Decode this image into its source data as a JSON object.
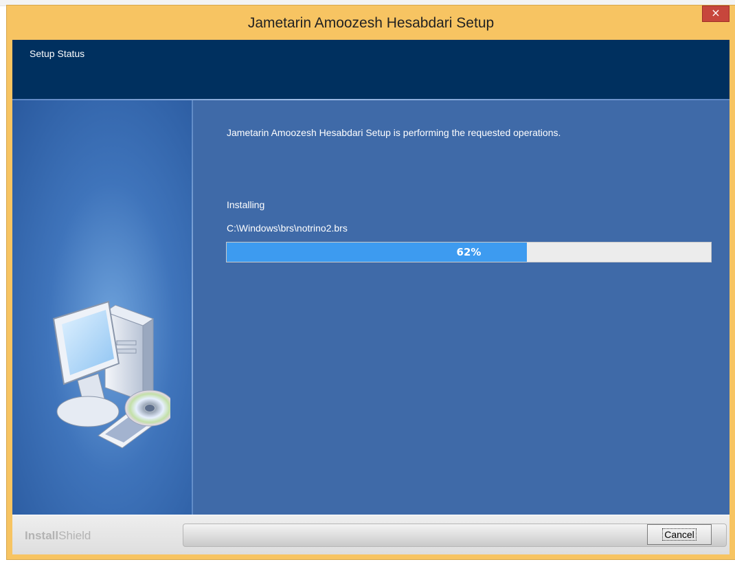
{
  "window": {
    "title": "Jametarin Amoozesh Hesabdari Setup",
    "close_glyph": "×"
  },
  "header": {
    "title": "Setup Status"
  },
  "main": {
    "status_message": "Jametarin Amoozesh Hesabdari Setup is performing the requested operations.",
    "action_label": "Installing",
    "current_file": "C:\\Windows\\brs\\notrino2.brs",
    "progress_percent": 62,
    "progress_text": "62%"
  },
  "footer": {
    "brand_bold": "Install",
    "brand_light": "Shield",
    "cancel_label": "Cancel"
  },
  "colors": {
    "titlebar": "#f7c462",
    "header_bg": "#00305f",
    "body_bg": "#3f6aa8",
    "progress_fill": "#3d9bf0",
    "close_button": "#c7463c"
  },
  "icons": {
    "illustration": "computer-with-cd-icon",
    "close": "close-icon"
  }
}
